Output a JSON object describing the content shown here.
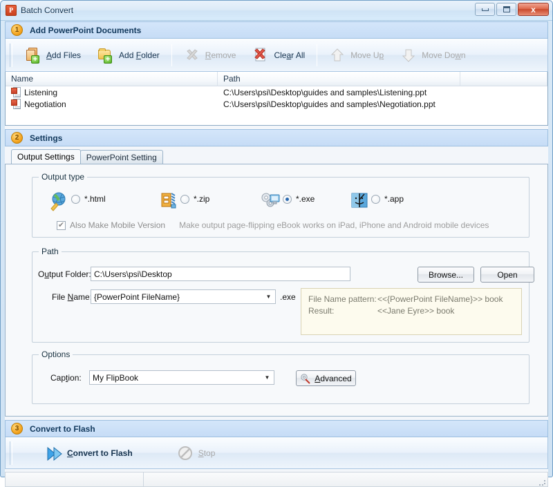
{
  "window": {
    "title": "Batch Convert",
    "app_icon": "powerpoint-icon",
    "icon_letter": "P",
    "minimize_label": "Minimize",
    "maximize_label": "Maximize",
    "close_label": "x"
  },
  "sections": {
    "add_documents": {
      "number": "1",
      "title": "Add PowerPoint Documents"
    },
    "settings": {
      "number": "2",
      "title": "Settings"
    },
    "convert": {
      "number": "3",
      "title": "Convert to Flash"
    }
  },
  "toolbar": {
    "add_files": "Add Files",
    "add_folder": "Add Folder",
    "remove": "Remove",
    "clear_all": "Clear All",
    "move_up": "Move Up",
    "move_down": "Move Down"
  },
  "filelist": {
    "columns": [
      "Name",
      "Path",
      ""
    ],
    "rows": [
      {
        "name": "Listening",
        "path": "C:\\Users\\psi\\Desktop\\guides and samples\\Listening.ppt"
      },
      {
        "name": "Negotiation",
        "path": "C:\\Users\\psi\\Desktop\\guides and samples\\Negotiation.ppt"
      }
    ]
  },
  "tabs": [
    {
      "label": "Output Settings",
      "active": true
    },
    {
      "label": "PowerPoint Setting",
      "active": false
    }
  ],
  "output_type": {
    "caption": "Output type",
    "options": [
      {
        "label": "*.html",
        "icon": "globe-pencil-icon",
        "selected": false
      },
      {
        "label": "*.zip",
        "icon": "zip-archive-icon",
        "selected": false
      },
      {
        "label": "*.exe",
        "icon": "gears-monitor-icon",
        "selected": true
      },
      {
        "label": "*.app",
        "icon": "mac-face-icon",
        "selected": false
      }
    ],
    "mobile_checkbox": {
      "label": "Also Make Mobile Version",
      "checked": true
    },
    "mobile_hint": "Make output page-flipping eBook works on iPad, iPhone and Android mobile devices"
  },
  "path": {
    "caption": "Path",
    "output_folder_label": "Output Folder:",
    "output_folder_value": "C:\\Users\\psi\\Desktop",
    "file_name_label": "File Name:",
    "file_name_value": "{PowerPoint FileName}",
    "extension": ".exe",
    "browse_label": "Browse...",
    "open_label": "Open",
    "pattern_label": "File Name pattern:",
    "pattern_value": "<<{PowerPoint FileName}>> book",
    "result_label": "Result:",
    "result_value": "<<Jane Eyre>> book"
  },
  "options": {
    "caption": "Options",
    "caption_label": "Caption:",
    "caption_value": "My FlipBook",
    "advanced_label": "Advanced"
  },
  "convert_bar": {
    "convert_label": "Convert to Flash",
    "stop_label": "Stop"
  },
  "colors": {
    "accent": "#2a6ab0",
    "badge": "#f5a623",
    "title_blue": "#11385c",
    "panel_blue": "#c6dcf6"
  }
}
